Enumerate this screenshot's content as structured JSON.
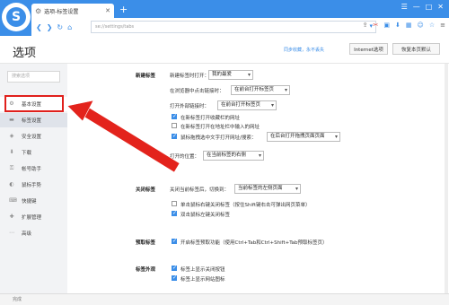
{
  "browser": {
    "tab_title": "选项-标签设置",
    "new_tab_glyph": "+",
    "address_hint": "se://settings/tabs",
    "win_buttons": [
      "☰",
      "—",
      "□",
      "✕"
    ],
    "toolbar_icons": [
      "sendto-icon",
      "cut-icon",
      "cards-icon",
      "download-icon",
      "tile-icon",
      "face-icon",
      "star-icon",
      "menu-icon"
    ]
  },
  "header": {
    "title": "选项",
    "sync_text": "同步收藏，永不丢失",
    "buttons": [
      "Internet选项",
      "恢复本页默认"
    ]
  },
  "sidebar": {
    "search_placeholder": "搜索选项",
    "items": [
      {
        "label": "基本设置",
        "icon": "gear-icon"
      },
      {
        "label": "标签设置",
        "icon": "tab-icon"
      },
      {
        "label": "安全设置",
        "icon": "shield-icon"
      },
      {
        "label": "下载",
        "icon": "download-icon"
      },
      {
        "label": "帐号助手",
        "icon": "key-icon"
      },
      {
        "label": "鼠标手势",
        "icon": "mouse-icon"
      },
      {
        "label": "快捷键",
        "icon": "keyboard-icon"
      },
      {
        "label": "扩展管理",
        "icon": "puzzle-icon"
      },
      {
        "label": "高级",
        "icon": "more-icon"
      }
    ]
  },
  "content": {
    "new_tab": {
      "section": "新建标签",
      "open_label": "新建标签时打开：",
      "open_value": "我的最爱",
      "addr_label": "在浏览器中点击链接时：",
      "addr_value": "在前台打开标签页",
      "ext_label": "打开外部链接时：",
      "ext_value": "在前台打开标签页",
      "check1": "在新标签打开收藏栏的网址",
      "check2": "在新标签打开在地址栏中输入的网址",
      "check3": "鼠标拖拽选中文字打开网址/搜索：",
      "check3_value": "在后台打开拖拽页面页面",
      "open_pos_label": "打开的位置：",
      "open_pos_value": "在当前标签的右侧"
    },
    "close_tab": {
      "section": "关闭标签",
      "after_label": "关闭当前标签后，切换到：",
      "after_value": "当前标签的左侧页面",
      "check1": "单击鼠标右键关闭标签（按住Shift键右击可弹出网页菜单）",
      "check2": "双击鼠标左键关闭标签"
    },
    "preload": {
      "section": "预取标签",
      "check1": "开启标签预取功能（使用Ctrl+Tab和Ctrl+Shift+Tab预取标签页）"
    },
    "appearance": {
      "section": "标签外观",
      "check1": "标签上显示关闭按钮",
      "check2": "标签上显示网站图标"
    }
  },
  "status": {
    "text": "完成"
  }
}
